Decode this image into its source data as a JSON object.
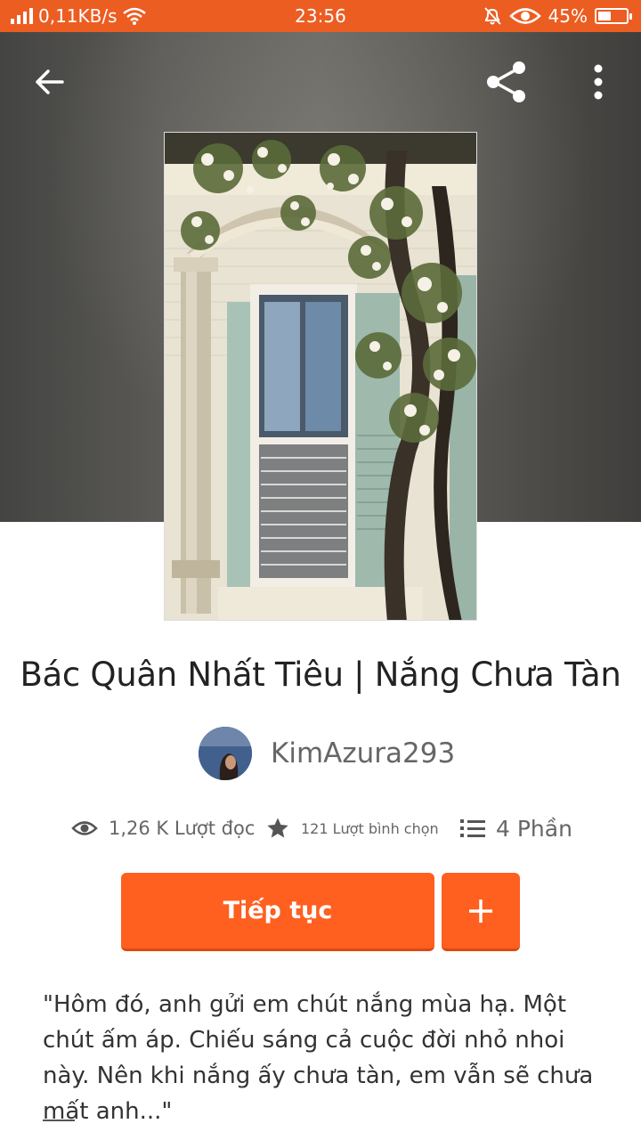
{
  "status_bar": {
    "network_speed": "0,11KB/s",
    "time": "23:56",
    "battery_percent": "45%",
    "battery_level": 0.45,
    "icons": [
      "signal-icon",
      "wifi-icon",
      "mute-icon",
      "eye-icon",
      "battery-icon"
    ]
  },
  "header": {
    "back_icon": "arrow-left-icon",
    "share_icon": "share-icon",
    "more_icon": "more-vertical-icon"
  },
  "story": {
    "title": "Bác Quân Nhất Tiêu | Nắng Chưa Tàn",
    "author": "KimAzura293",
    "reads": "1,26 K Lượt đọc",
    "votes": "121 Lượt bình chọn",
    "parts": "4 Phần",
    "description": "\"Hôm đó, anh gửi em chút nắng mùa hạ. Một chút ấm áp. Chiếu sáng cả cuộc đời nhỏ nhoi này. Nên khi nắng ấy chưa tàn, em vẫn sẽ chưa mất anh...\""
  },
  "actions": {
    "continue_label": "Tiếp tục",
    "add_label": "+"
  },
  "colors": {
    "accent": "#ff5f1f",
    "status_bar": "#ec5d22"
  }
}
